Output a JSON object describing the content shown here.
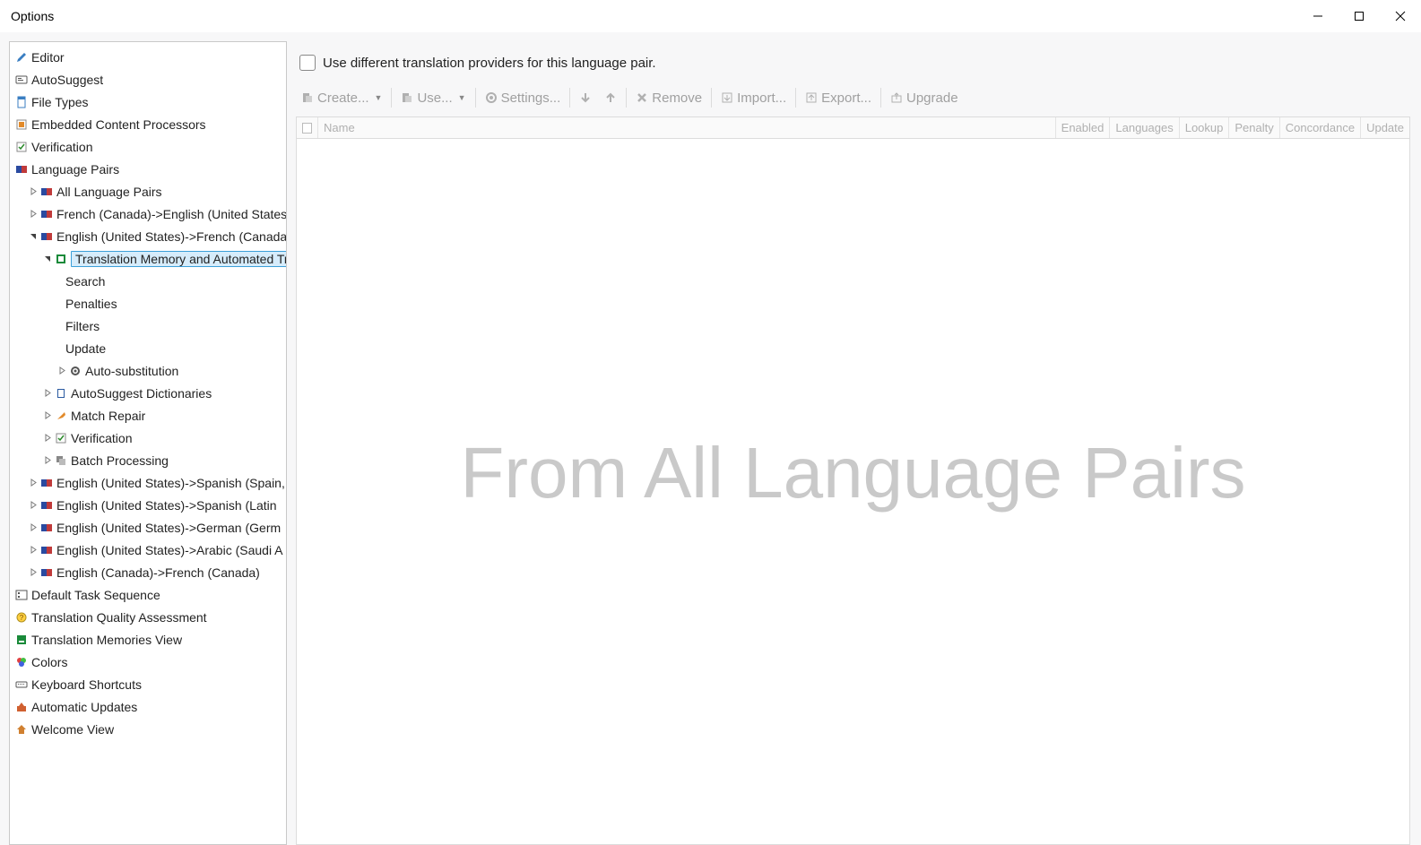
{
  "window_title": "Options",
  "titlebar": {
    "minimize": "−",
    "maximize": "□",
    "close": "✕"
  },
  "sidebar": {
    "items": [
      {
        "label": "Editor",
        "icon": "pencil"
      },
      {
        "label": "AutoSuggest",
        "icon": "autosuggest"
      },
      {
        "label": "File Types",
        "icon": "filetypes"
      },
      {
        "label": "Embedded Content Processors",
        "icon": "embedded"
      },
      {
        "label": "Verification",
        "icon": "verify"
      },
      {
        "label": "Language Pairs",
        "icon": "langpair"
      },
      {
        "label": "All Language Pairs",
        "icon": "langpair",
        "indent": 1,
        "expander": "closed"
      },
      {
        "label": "French (Canada)->English (United States)",
        "icon": "langpair",
        "indent": 1,
        "expander": "closed"
      },
      {
        "label": "English (United States)->French (Canada)",
        "icon": "langpair",
        "indent": 1,
        "expander": "open"
      },
      {
        "label": "Translation Memory and Automated Translation",
        "icon": "tm",
        "indent": 2,
        "expander": "open",
        "selected": true
      },
      {
        "label": "Search",
        "icon": "",
        "indent": 3,
        "noexp": true
      },
      {
        "label": "Penalties",
        "icon": "",
        "indent": 3,
        "noexp": true
      },
      {
        "label": "Filters",
        "icon": "",
        "indent": 3,
        "noexp": true
      },
      {
        "label": "Update",
        "icon": "",
        "indent": 3,
        "noexp": true
      },
      {
        "label": "Auto-substitution",
        "icon": "gear",
        "indent": 3,
        "expander": "closed"
      },
      {
        "label": "AutoSuggest Dictionaries",
        "icon": "asdict",
        "indent": 2,
        "expander": "closed"
      },
      {
        "label": "Match Repair",
        "icon": "wrench",
        "indent": 2,
        "expander": "closed"
      },
      {
        "label": "Verification",
        "icon": "verify",
        "indent": 2,
        "expander": "closed"
      },
      {
        "label": "Batch Processing",
        "icon": "batch",
        "indent": 2,
        "expander": "closed"
      },
      {
        "label": "English (United States)->Spanish (Spain,",
        "icon": "langpair",
        "indent": 1,
        "expander": "closed"
      },
      {
        "label": "English (United States)->Spanish (Latin",
        "icon": "langpair",
        "indent": 1,
        "expander": "closed"
      },
      {
        "label": "English (United States)->German (Germ",
        "icon": "langpair",
        "indent": 1,
        "expander": "closed"
      },
      {
        "label": "English (United States)->Arabic (Saudi A",
        "icon": "langpair",
        "indent": 1,
        "expander": "closed"
      },
      {
        "label": "English (Canada)->French (Canada)",
        "icon": "langpair",
        "indent": 1,
        "expander": "closed"
      },
      {
        "label": "Default Task Sequence",
        "icon": "tasks"
      },
      {
        "label": "Translation Quality Assessment",
        "icon": "tqa"
      },
      {
        "label": "Translation Memories View",
        "icon": "tmview"
      },
      {
        "label": "Colors",
        "icon": "colors"
      },
      {
        "label": "Keyboard Shortcuts",
        "icon": "keyboard"
      },
      {
        "label": "Automatic Updates",
        "icon": "updates"
      },
      {
        "label": "Welcome View",
        "icon": "home"
      }
    ]
  },
  "content": {
    "checkbox_label": "Use different translation providers for this language pair.",
    "toolbar": {
      "create": "Create...",
      "use": "Use...",
      "settings": "Settings...",
      "remove": "Remove",
      "import": "Import...",
      "export": "Export...",
      "upgrade": "Upgrade"
    },
    "grid_headers": {
      "name": "Name",
      "enabled": "Enabled",
      "languages": "Languages",
      "lookup": "Lookup",
      "penalty": "Penalty",
      "concordance": "Concordance",
      "update": "Update"
    },
    "watermark": "From All Language Pairs"
  }
}
